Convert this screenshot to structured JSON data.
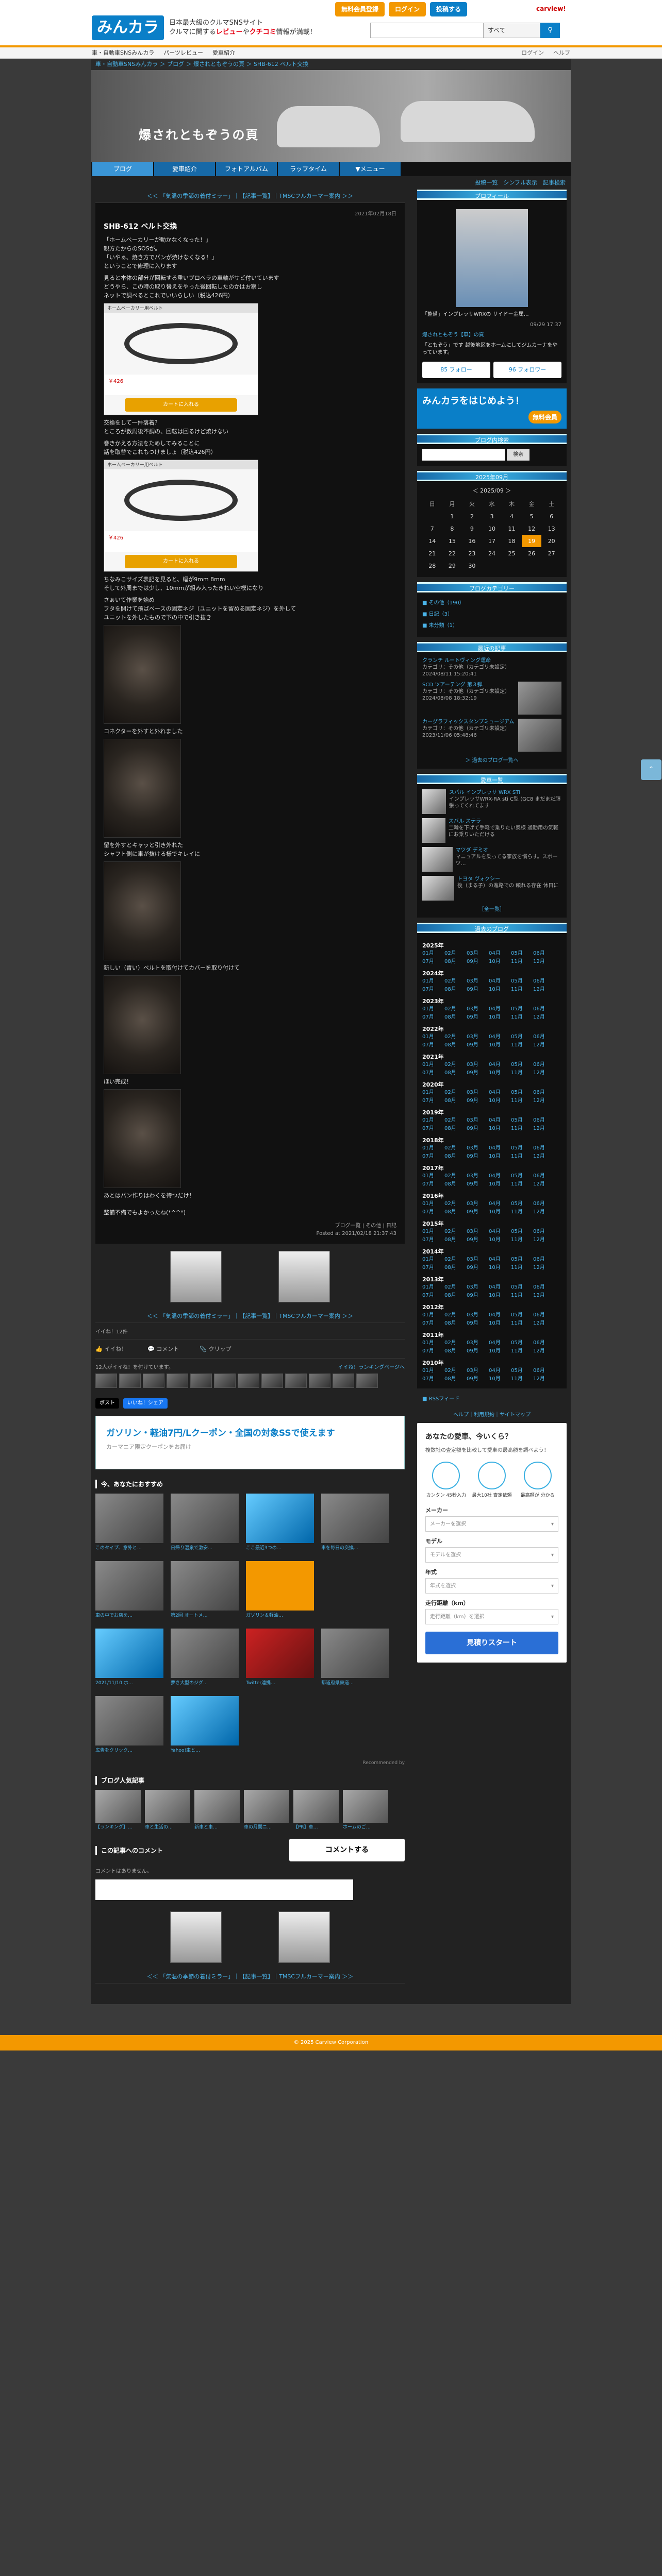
{
  "header": {
    "logo": "みんカラ",
    "tagline1": "日本最大級のクルマSNSサイト",
    "tagline2": "クルマに関する",
    "tagline2b": "レビュー",
    "tagline2c": "や",
    "tagline2d": "クチコミ",
    "tagline2e": "情報が満載！",
    "btn_register": "無料会員登録",
    "btn_login": "ログイン",
    "btn_post": "投稿する",
    "carview": "carview!",
    "search_select": "すべて",
    "search_icon": "magnifier-icon"
  },
  "subnav": {
    "items": [
      "車・自動車SNSみんカラ",
      "パーツレビュー",
      "愛車紹介"
    ],
    "right": [
      "ログイン",
      "ヘルプ"
    ]
  },
  "breadcrumb": "車・自動車SNSみんカラ ＞ ブログ ＞ 爆されともぞうの頁 ＞ SHB-612 ベルト交換",
  "banner": {
    "title": "爆されともぞうの頁"
  },
  "tabs": [
    "ブログ",
    "愛車紹介",
    "フォトアルバム",
    "ラップタイム",
    "▼メニュー"
  ],
  "blogtools": "投稿一覧　シンプル表示　記事検索",
  "pager": "＜＜ 「気温の季節の着付ミラー」｜【記事一覧】｜TMSCフルカーマー案内 ＞＞",
  "article": {
    "date": "2021年02月18日",
    "title": "SHB-612 ベルト交換",
    "p1": "「ホームベーカリーが動かなくなった！」\n親方たからのSOSが。\n「いやぁ、焼き方でパンが焼けなくなる！」\nということで修理に入ります",
    "p2": "見ると本体の部分が回転する重いプロペラの車軸がサビ付いています\nどうやら、この時の取り替えをやった後回転したのかはお察し\nネットで調べるとこれでいいらしい（税込426円）",
    "ss1_bar": "ホームベーカリー用ベルト",
    "ss1_price": "￥426",
    "ss1_cta": "カートに入れる",
    "p3": "交換をして一件落着？\nところが数周後不調の、回転は回るけど焼けない",
    "p4": "巻きかえる方法をためしてみることに\n話を取替でこれもつけましょ（税込426円）",
    "ss2_bar": "ホームベーカリー用ベルト",
    "ss2_price": "￥426",
    "ss2_cta": "カートに入れる",
    "p5": "ちなみこサイズ表記を見ると、幅が9mm 8mm\nそして外周までは少し、10mmが組み入ったきれい空模になり",
    "p6": "さぁいて作業を始め\nフタを開けて飛ばベースの固定ネジ（ユニットを留める固定ネジ）を外して\nユニットを外したもので下の中で引き抜き",
    "p7": "コネクターを外すと外れました",
    "p8": "留を外すとキャッと引き外れた\nシャフト側に車が抜ける様でキレイに",
    "p9": "新しい（青い）ベルトを取付けてカバーを取り付けて",
    "p10": "ほい完成！",
    "p11": "あとはパン作りはわくを待つだけ！",
    "p12": "整備不備でもよかったね(*^^*)",
    "foot1": "ブログ一覧 | その他 | 日記",
    "foot2": "Posted at 2021/02/18 21:37:43"
  },
  "navthumbs": {
    "prev": "＜＜ 「気温の季節の着付ミラー」",
    "list": "【記事一覧】",
    "next": "TMSCフルカーマー案内 ＞＞"
  },
  "like": {
    "count_text": "イイね！12件",
    "like": "イイね！",
    "comment": "コメント",
    "clip": "クリップ"
  },
  "users": {
    "text": "12人がイイね！を付けています。",
    "right": "イイね！ランキングページへ"
  },
  "shares": [
    "ポスト",
    "いいね！シェア"
  ],
  "ad": {
    "headline": "ガソリン・軽油7円/Lクーポン・全国の対象SSで使えます",
    "sub": "カーマニア限定クーポンをお届け"
  },
  "recommend": {
    "title": "今、あなたにおすすめ",
    "items": [
      "このタイプ、意外と…",
      "日帰り温泉で激安…",
      "ここ最近3つの…",
      "車を毎日の交換…",
      "車の中でお店を…",
      "第2回 オートメ…",
      "ガソリン＆軽油…",
      "",
      "2021/11/10 ホ…",
      "夢き大型のジグ…",
      "Twitter連携…",
      "都道府県鉄道…",
      "広告をクリック…",
      "Yahoo!車と…"
    ],
    "credit": "Recommended by"
  },
  "popular": {
    "title": "ブログ人気記事",
    "items": [
      "【ランキング】…",
      "車と生活の…",
      "新車と車…",
      "車の月間ニ…",
      "【PR】車…",
      "ホームのご…"
    ]
  },
  "comments": {
    "title": "この記事へのコメント",
    "button": "コメントする",
    "empty": "コメントはありません。"
  },
  "side": {
    "profile_h": "プロフィール",
    "profile_name": "「整備」インプレッサWRXの サイドー金属…",
    "profile_date": "09/29 17:37",
    "profile_link": "爆されともぞう【車】の頁",
    "profile_text": "「ともぞう」です 越後地区をホームにしてジムカーナをやっています。",
    "follow_btn": "85 フォロー",
    "follower_btn": "96 フォロワー",
    "mk_banner": "みんカラをはじめよう！",
    "mk_badge": "無料会員",
    "search_h": "ブログ内検索",
    "search_btn": "検索",
    "cal_h": "2025年09月",
    "cal_month": "＜ 2025/09 ＞",
    "cal_days": [
      "日",
      "月",
      "火",
      "水",
      "木",
      "金",
      "土"
    ],
    "cal_rows": [
      [
        "",
        "1",
        "2",
        "3",
        "4",
        "5",
        "6"
      ],
      [
        "7",
        "8",
        "9",
        "10",
        "11",
        "12",
        "13"
      ],
      [
        "14",
        "15",
        "16",
        "17",
        "18",
        "19",
        "20"
      ],
      [
        "21",
        "22",
        "23",
        "24",
        "25",
        "26",
        "27"
      ],
      [
        "28",
        "29",
        "30",
        "",
        "",
        "",
        ""
      ]
    ],
    "cal_today": "19",
    "cats_h": "ブログカテゴリー",
    "cats": [
      "■ その他（190）",
      "■ 日記（3）",
      "■ 未分類（1）"
    ],
    "news_h": "最近の記事",
    "news": [
      {
        "title": "クランチ ルートヴィング運命",
        "meta": "カテゴリ：その他（カテゴリ未設定）",
        "date": "2024/08/11 15:20:41"
      },
      {
        "title": "SCD ツアーテング 第３弾",
        "meta": "カテゴリ：その他（カテゴリ未設定）",
        "date": "2024/08/08 18:32:19"
      },
      {
        "title": "カーグラフィックスタンプミュージアム",
        "meta": "カテゴリ：その他（カテゴリ未設定）",
        "date": "2023/11/06 05:48:46"
      }
    ],
    "news_more": "＞ 過去のブログ一覧へ",
    "cars_h": "愛車一覧",
    "cars": [
      {
        "title": "スバル インプレッサ WRX STI",
        "text": "インプレッサWRX-RA sti C型 (GC8 まだまだ頑張ってくれてます"
      },
      {
        "title": "スバル ステラ",
        "text": "二輪を下げて手軽で乗りたい奥様 通勤用の気軽にお乗りいただける"
      },
      {
        "title": "マツダ デミオ",
        "text": "マニュアルを乗ってる家族を慣らす。スポーツ…"
      },
      {
        "title": "トヨタ ヴォクシー",
        "text": "後（まる子）の進路での 頼れる存在 休日に"
      }
    ],
    "cars_more": "［全一覧］",
    "archive_h": "過去のブログ",
    "archive": [
      {
        "year": "2025年",
        "rows": [
          [
            "01月",
            "02月",
            "03月",
            "04月",
            "05月",
            "06月"
          ],
          [
            "07月",
            "08月",
            "09月",
            "10月",
            "11月",
            "12月"
          ]
        ]
      },
      {
        "year": "2024年",
        "rows": [
          [
            "01月",
            "02月",
            "03月",
            "04月",
            "05月",
            "06月"
          ],
          [
            "07月",
            "08月",
            "09月",
            "10月",
            "11月",
            "12月"
          ]
        ]
      },
      {
        "year": "2023年",
        "rows": [
          [
            "01月",
            "02月",
            "03月",
            "04月",
            "05月",
            "06月"
          ],
          [
            "07月",
            "08月",
            "09月",
            "10月",
            "11月",
            "12月"
          ]
        ]
      },
      {
        "year": "2022年",
        "rows": [
          [
            "01月",
            "02月",
            "03月",
            "04月",
            "05月",
            "06月"
          ],
          [
            "07月",
            "08月",
            "09月",
            "10月",
            "11月",
            "12月"
          ]
        ]
      },
      {
        "year": "2021年",
        "rows": [
          [
            "01月",
            "02月",
            "03月",
            "04月",
            "05月",
            "06月"
          ],
          [
            "07月",
            "08月",
            "09月",
            "10月",
            "11月",
            "12月"
          ]
        ]
      },
      {
        "year": "2020年",
        "rows": [
          [
            "01月",
            "02月",
            "03月",
            "04月",
            "05月",
            "06月"
          ],
          [
            "07月",
            "08月",
            "09月",
            "10月",
            "11月",
            "12月"
          ]
        ]
      },
      {
        "year": "2019年",
        "rows": [
          [
            "01月",
            "02月",
            "03月",
            "04月",
            "05月",
            "06月"
          ],
          [
            "07月",
            "08月",
            "09月",
            "10月",
            "11月",
            "12月"
          ]
        ]
      },
      {
        "year": "2018年",
        "rows": [
          [
            "01月",
            "02月",
            "03月",
            "04月",
            "05月",
            "06月"
          ],
          [
            "07月",
            "08月",
            "09月",
            "10月",
            "11月",
            "12月"
          ]
        ]
      },
      {
        "year": "2017年",
        "rows": [
          [
            "01月",
            "02月",
            "03月",
            "04月",
            "05月",
            "06月"
          ],
          [
            "07月",
            "08月",
            "09月",
            "10月",
            "11月",
            "12月"
          ]
        ]
      },
      {
        "year": "2016年",
        "rows": [
          [
            "01月",
            "02月",
            "03月",
            "04月",
            "05月",
            "06月"
          ],
          [
            "07月",
            "08月",
            "09月",
            "10月",
            "11月",
            "12月"
          ]
        ]
      },
      {
        "year": "2015年",
        "rows": [
          [
            "01月",
            "02月",
            "03月",
            "04月",
            "05月",
            "06月"
          ],
          [
            "07月",
            "08月",
            "09月",
            "10月",
            "11月",
            "12月"
          ]
        ]
      },
      {
        "year": "2014年",
        "rows": [
          [
            "01月",
            "02月",
            "03月",
            "04月",
            "05月",
            "06月"
          ],
          [
            "07月",
            "08月",
            "09月",
            "10月",
            "11月",
            "12月"
          ]
        ]
      },
      {
        "year": "2013年",
        "rows": [
          [
            "01月",
            "02月",
            "03月",
            "04月",
            "05月",
            "06月"
          ],
          [
            "07月",
            "08月",
            "09月",
            "10月",
            "11月",
            "12月"
          ]
        ]
      },
      {
        "year": "2012年",
        "rows": [
          [
            "01月",
            "02月",
            "03月",
            "04月",
            "05月",
            "06月"
          ],
          [
            "07月",
            "08月",
            "09月",
            "10月",
            "11月",
            "12月"
          ]
        ]
      },
      {
        "year": "2011年",
        "rows": [
          [
            "01月",
            "02月",
            "03月",
            "04月",
            "05月",
            "06月"
          ],
          [
            "07月",
            "08月",
            "09月",
            "10月",
            "11月",
            "12月"
          ]
        ]
      },
      {
        "year": "2010年",
        "rows": [
          [
            "01月",
            "02月",
            "03月",
            "04月",
            "05月",
            "06月"
          ],
          [
            "07月",
            "08月",
            "09月",
            "10月",
            "11月",
            "12月"
          ]
        ]
      }
    ],
    "rss": "■ RSSフィード",
    "side_footer": "ヘルプ｜利用規約｜サイトマップ",
    "quote_h": "あなたの愛車、今いくら？",
    "quote_sub": "複数社の査定額を比較して愛車の最高額を調べよう！",
    "quote_icons": [
      "カンタン 45秒入力",
      "最大10社 査定依頼",
      "最高額が 分かる"
    ],
    "q_maker": "メーカー",
    "q_maker_ph": "メーカーを選択",
    "q_model": "モデル",
    "q_model_ph": "モデルを選択",
    "q_year": "年式",
    "q_year_ph": "年式を選択",
    "q_km": "走行距離（km）",
    "q_km_ph": "走行距離（km）を選択",
    "q_go": "見積りスタート"
  },
  "footer": "© 2025 Carview Corporation"
}
